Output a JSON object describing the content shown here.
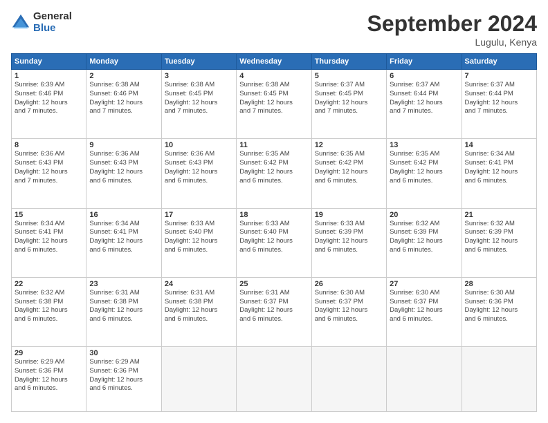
{
  "logo": {
    "general": "General",
    "blue": "Blue"
  },
  "title": "September 2024",
  "location": "Lugulu, Kenya",
  "days_of_week": [
    "Sunday",
    "Monday",
    "Tuesday",
    "Wednesday",
    "Thursday",
    "Friday",
    "Saturday"
  ],
  "weeks": [
    [
      {
        "day": "1",
        "info": "Sunrise: 6:39 AM\nSunset: 6:46 PM\nDaylight: 12 hours\nand 7 minutes."
      },
      {
        "day": "2",
        "info": "Sunrise: 6:38 AM\nSunset: 6:46 PM\nDaylight: 12 hours\nand 7 minutes."
      },
      {
        "day": "3",
        "info": "Sunrise: 6:38 AM\nSunset: 6:45 PM\nDaylight: 12 hours\nand 7 minutes."
      },
      {
        "day": "4",
        "info": "Sunrise: 6:38 AM\nSunset: 6:45 PM\nDaylight: 12 hours\nand 7 minutes."
      },
      {
        "day": "5",
        "info": "Sunrise: 6:37 AM\nSunset: 6:45 PM\nDaylight: 12 hours\nand 7 minutes."
      },
      {
        "day": "6",
        "info": "Sunrise: 6:37 AM\nSunset: 6:44 PM\nDaylight: 12 hours\nand 7 minutes."
      },
      {
        "day": "7",
        "info": "Sunrise: 6:37 AM\nSunset: 6:44 PM\nDaylight: 12 hours\nand 7 minutes."
      }
    ],
    [
      {
        "day": "8",
        "info": "Sunrise: 6:36 AM\nSunset: 6:43 PM\nDaylight: 12 hours\nand 7 minutes."
      },
      {
        "day": "9",
        "info": "Sunrise: 6:36 AM\nSunset: 6:43 PM\nDaylight: 12 hours\nand 6 minutes."
      },
      {
        "day": "10",
        "info": "Sunrise: 6:36 AM\nSunset: 6:43 PM\nDaylight: 12 hours\nand 6 minutes."
      },
      {
        "day": "11",
        "info": "Sunrise: 6:35 AM\nSunset: 6:42 PM\nDaylight: 12 hours\nand 6 minutes."
      },
      {
        "day": "12",
        "info": "Sunrise: 6:35 AM\nSunset: 6:42 PM\nDaylight: 12 hours\nand 6 minutes."
      },
      {
        "day": "13",
        "info": "Sunrise: 6:35 AM\nSunset: 6:42 PM\nDaylight: 12 hours\nand 6 minutes."
      },
      {
        "day": "14",
        "info": "Sunrise: 6:34 AM\nSunset: 6:41 PM\nDaylight: 12 hours\nand 6 minutes."
      }
    ],
    [
      {
        "day": "15",
        "info": "Sunrise: 6:34 AM\nSunset: 6:41 PM\nDaylight: 12 hours\nand 6 minutes."
      },
      {
        "day": "16",
        "info": "Sunrise: 6:34 AM\nSunset: 6:41 PM\nDaylight: 12 hours\nand 6 minutes."
      },
      {
        "day": "17",
        "info": "Sunrise: 6:33 AM\nSunset: 6:40 PM\nDaylight: 12 hours\nand 6 minutes."
      },
      {
        "day": "18",
        "info": "Sunrise: 6:33 AM\nSunset: 6:40 PM\nDaylight: 12 hours\nand 6 minutes."
      },
      {
        "day": "19",
        "info": "Sunrise: 6:33 AM\nSunset: 6:39 PM\nDaylight: 12 hours\nand 6 minutes."
      },
      {
        "day": "20",
        "info": "Sunrise: 6:32 AM\nSunset: 6:39 PM\nDaylight: 12 hours\nand 6 minutes."
      },
      {
        "day": "21",
        "info": "Sunrise: 6:32 AM\nSunset: 6:39 PM\nDaylight: 12 hours\nand 6 minutes."
      }
    ],
    [
      {
        "day": "22",
        "info": "Sunrise: 6:32 AM\nSunset: 6:38 PM\nDaylight: 12 hours\nand 6 minutes."
      },
      {
        "day": "23",
        "info": "Sunrise: 6:31 AM\nSunset: 6:38 PM\nDaylight: 12 hours\nand 6 minutes."
      },
      {
        "day": "24",
        "info": "Sunrise: 6:31 AM\nSunset: 6:38 PM\nDaylight: 12 hours\nand 6 minutes."
      },
      {
        "day": "25",
        "info": "Sunrise: 6:31 AM\nSunset: 6:37 PM\nDaylight: 12 hours\nand 6 minutes."
      },
      {
        "day": "26",
        "info": "Sunrise: 6:30 AM\nSunset: 6:37 PM\nDaylight: 12 hours\nand 6 minutes."
      },
      {
        "day": "27",
        "info": "Sunrise: 6:30 AM\nSunset: 6:37 PM\nDaylight: 12 hours\nand 6 minutes."
      },
      {
        "day": "28",
        "info": "Sunrise: 6:30 AM\nSunset: 6:36 PM\nDaylight: 12 hours\nand 6 minutes."
      }
    ],
    [
      {
        "day": "29",
        "info": "Sunrise: 6:29 AM\nSunset: 6:36 PM\nDaylight: 12 hours\nand 6 minutes."
      },
      {
        "day": "30",
        "info": "Sunrise: 6:29 AM\nSunset: 6:36 PM\nDaylight: 12 hours\nand 6 minutes."
      },
      {
        "day": "",
        "info": ""
      },
      {
        "day": "",
        "info": ""
      },
      {
        "day": "",
        "info": ""
      },
      {
        "day": "",
        "info": ""
      },
      {
        "day": "",
        "info": ""
      }
    ]
  ]
}
